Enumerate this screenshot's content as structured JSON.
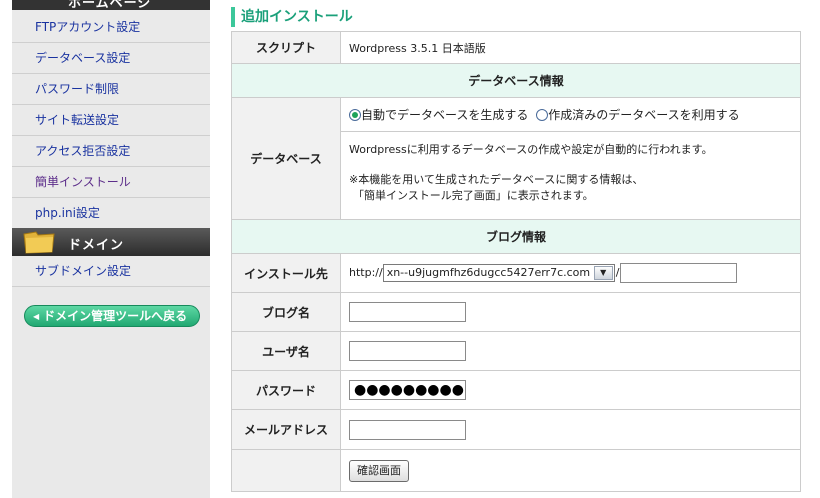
{
  "sidebar": {
    "top_section_label": "ホームページ",
    "items": [
      {
        "label": "FTPアカウント設定"
      },
      {
        "label": "データベース設定"
      },
      {
        "label": "パスワード制限"
      },
      {
        "label": "サイト転送設定"
      },
      {
        "label": "アクセス拒否設定"
      },
      {
        "label": "簡単インストール"
      },
      {
        "label": "php.ini設定"
      }
    ],
    "domain_section_label": "ドメイン",
    "domain_items": [
      {
        "label": "サブドメイン設定"
      }
    ],
    "back_button_label": "ドメイン管理ツールへ戻る"
  },
  "main": {
    "title": "追加インストール",
    "script_label": "スクリプト",
    "script_value": "Wordpress 3.5.1 日本語版",
    "db_section_title": "データベース情報",
    "db_label": "データベース",
    "db_option_auto": "自動でデータベースを生成する",
    "db_option_existing": "作成済みのデータベースを利用する",
    "db_description": "Wordpressに利用するデータベースの作成や設定が自動的に行われます。",
    "db_note_line1": "※本機能を用いて生成されたデータベースに関する情報は、",
    "db_note_line2": "「簡単インストール完了画面」に表示されます。",
    "blog_section_title": "ブログ情報",
    "install_label": "インストール先",
    "install_prefix": "http://",
    "install_domain": "xn--u9jugmfhz6dugcc5427err7c.com",
    "install_separator": "/",
    "install_path_value": "",
    "blog_name_label": "ブログ名",
    "blog_name_value": "",
    "username_label": "ユーザ名",
    "username_value": "",
    "password_label": "パスワード",
    "password_value": "●●●●●●●●●",
    "email_label": "メールアドレス",
    "email_value": "",
    "confirm_button_label": "確認画面"
  },
  "colors": {
    "accent": "#1aa07a",
    "section_bg": "#e7f8f2",
    "label_bg": "#f1f1f1",
    "link": "#1a33a0"
  }
}
